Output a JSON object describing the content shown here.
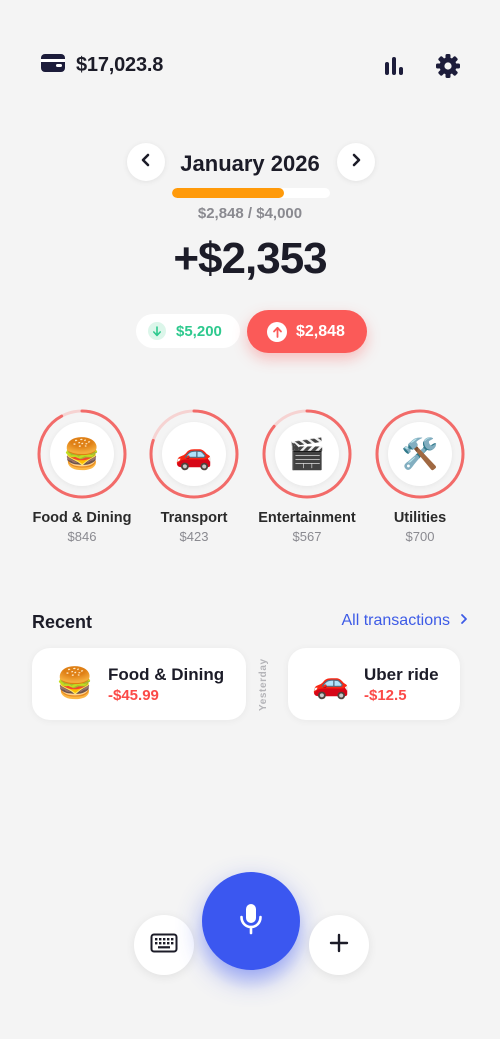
{
  "header": {
    "balance": "$17,023.8",
    "icons": [
      "wallet-icon",
      "stats-icon",
      "settings-icon"
    ]
  },
  "period": {
    "month_label": "January 2026",
    "budget_text": "$2,848 / $4,000",
    "budget_progress": 0.712,
    "net_total": "+$2,353"
  },
  "flows": {
    "income": "$5,200",
    "expense": "$2,848"
  },
  "categories": [
    {
      "name": "Food & Dining",
      "amount": "$846",
      "icon": "🍔",
      "progress": 0.92
    },
    {
      "name": "Transport",
      "amount": "$423",
      "icon": "🚗",
      "progress": 0.8
    },
    {
      "name": "Entertainment",
      "amount": "$567",
      "icon": "🎬",
      "progress": 0.86
    },
    {
      "name": "Utilities",
      "amount": "$700",
      "icon": "🛠️",
      "progress": 1.0
    }
  ],
  "recent": {
    "title": "Recent",
    "all_link": "All transactions",
    "day_label": "Yesterday",
    "transactions": [
      {
        "name": "Food & Dining",
        "amount": "-$45.99",
        "icon": "🍔"
      },
      {
        "name": "Uber ride",
        "amount": "-$12.5",
        "icon": "🚗"
      }
    ]
  },
  "colors": {
    "accent": "#3b57f0",
    "expense": "#fb5a58",
    "income": "#2ec98e",
    "budget": "#ff9a0a"
  }
}
